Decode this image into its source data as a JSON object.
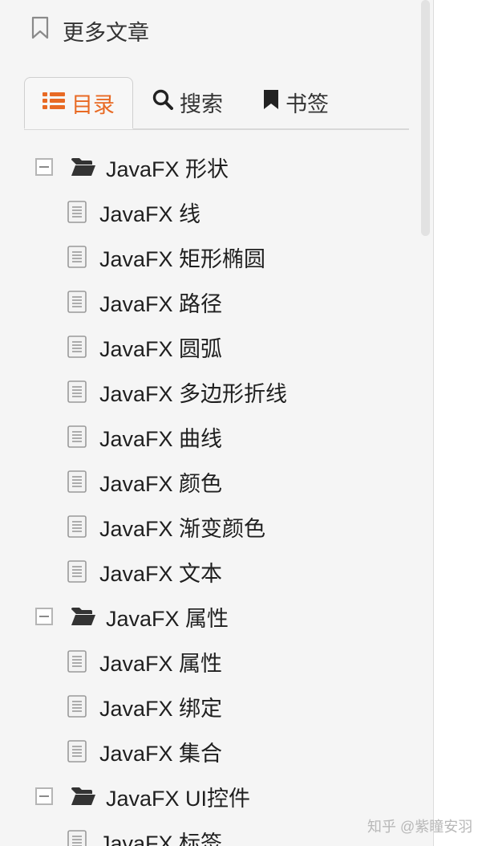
{
  "more_articles": {
    "label": "更多文章"
  },
  "tabs": {
    "toc": "目录",
    "search": "搜索",
    "bookmark": "书签"
  },
  "tree": [
    {
      "type": "folder",
      "label": "JavaFX 形状"
    },
    {
      "type": "leaf",
      "label": "JavaFX 线"
    },
    {
      "type": "leaf",
      "label": "JavaFX 矩形椭圆"
    },
    {
      "type": "leaf",
      "label": "JavaFX 路径"
    },
    {
      "type": "leaf",
      "label": "JavaFX 圆弧"
    },
    {
      "type": "leaf",
      "label": "JavaFX 多边形折线"
    },
    {
      "type": "leaf",
      "label": "JavaFX 曲线"
    },
    {
      "type": "leaf",
      "label": "JavaFX 颜色"
    },
    {
      "type": "leaf",
      "label": "JavaFX 渐变颜色"
    },
    {
      "type": "leaf",
      "label": "JavaFX 文本"
    },
    {
      "type": "folder",
      "label": "JavaFX 属性"
    },
    {
      "type": "leaf",
      "label": "JavaFX 属性"
    },
    {
      "type": "leaf",
      "label": "JavaFX 绑定"
    },
    {
      "type": "leaf",
      "label": "JavaFX 集合"
    },
    {
      "type": "folder",
      "label": "JavaFX UI控件"
    },
    {
      "type": "leaf",
      "label": "JavaFX 标签"
    }
  ],
  "watermark": "知乎 @紫瞳安羽",
  "colors": {
    "accent": "#e86a24",
    "text": "#1f1f1f",
    "panel_bg": "#f5f5f5"
  }
}
